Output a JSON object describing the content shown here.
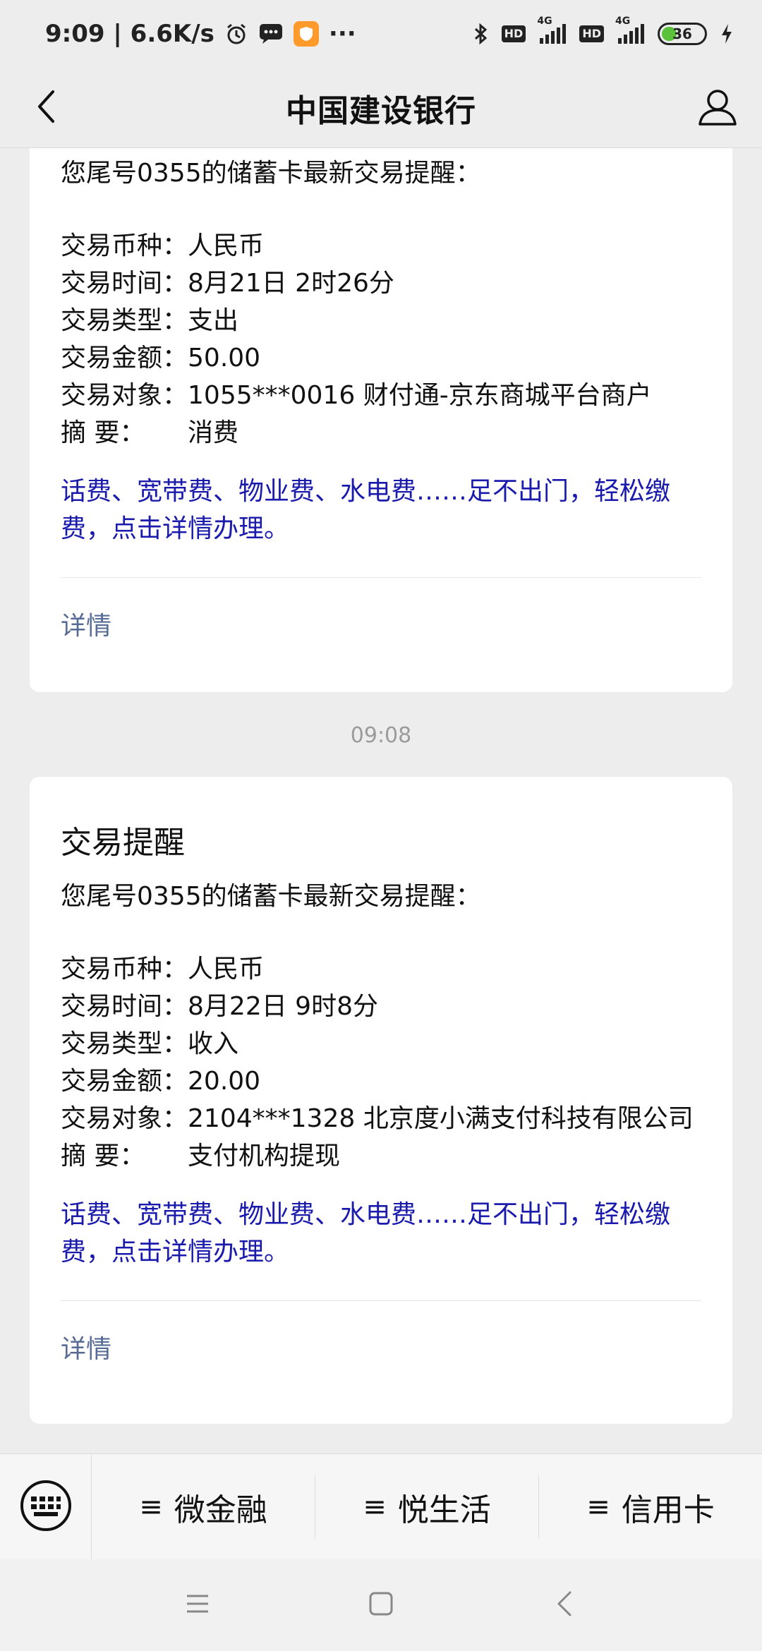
{
  "status_bar": {
    "time_speed": "9:09 | 6.6K/s",
    "more": "···",
    "hd1": "HD",
    "hd2": "HD",
    "net1": "4G",
    "net2": "4G",
    "battery": "36",
    "battery_fraction": 0.36
  },
  "nav": {
    "title": "中国建设银行"
  },
  "messages": [
    {
      "title": "",
      "intro": "您尾号0355的储蓄卡最新交易提醒：",
      "fields": [
        {
          "label": "交易币种：",
          "value": "人民币"
        },
        {
          "label": "交易时间：",
          "value": "8月21日 2时26分"
        },
        {
          "label": "交易类型：",
          "value": "支出"
        },
        {
          "label": "交易金额：",
          "value": "50.00"
        },
        {
          "label": "交易对象：",
          "value": "1055***0016 财付通-京东商城平台商户"
        }
      ],
      "summary": {
        "label": "摘        要：",
        "value": "消费"
      },
      "promo": "话费、宽带费、物业费、水电费……足不出门，轻松缴费，点击详情办理。",
      "detail": "详情"
    },
    {
      "title": "交易提醒",
      "intro": "您尾号0355的储蓄卡最新交易提醒：",
      "fields": [
        {
          "label": "交易币种：",
          "value": "人民币"
        },
        {
          "label": "交易时间：",
          "value": "8月22日 9时8分"
        },
        {
          "label": "交易类型：",
          "value": "收入"
        },
        {
          "label": "交易金额：",
          "value": "20.00"
        },
        {
          "label": "交易对象：",
          "value": "2104***1328 北京度小满支付科技有限公司"
        }
      ],
      "summary": {
        "label": "摘        要：",
        "value": "支付机构提现"
      },
      "promo": "话费、宽带费、物业费、水电费……足不出门，轻松缴费，点击详情办理。",
      "detail": "详情"
    }
  ],
  "timestamp": "09:08",
  "bottom_menu": {
    "items": [
      {
        "glyph": "≡",
        "label": "微金融"
      },
      {
        "glyph": "≡",
        "label": "悦生活"
      },
      {
        "glyph": "≡",
        "label": "信用卡"
      }
    ]
  },
  "icons": {
    "back": "chevron-left-icon",
    "user": "user-icon",
    "keyboard": "keyboard-icon",
    "sys_menu": "menu-icon",
    "sys_home": "home-square-icon",
    "sys_back": "back-triangle-icon"
  },
  "colors": {
    "background": "#ededed",
    "link_blue": "#1a1aad",
    "detail_link": "#576b95",
    "battery_green": "#59c23a"
  }
}
